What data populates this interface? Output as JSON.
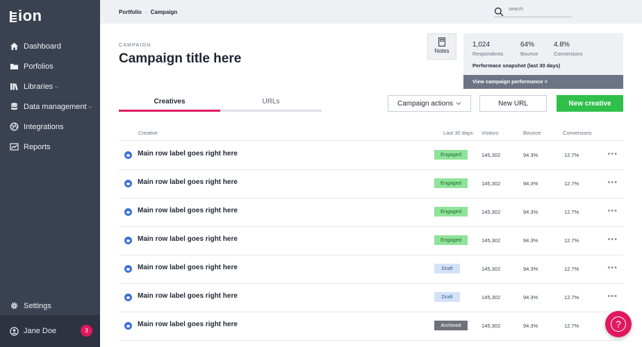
{
  "app": {
    "logo": "ion"
  },
  "sidebar": {
    "items": [
      {
        "label": "Dashboard",
        "icon": "home-icon"
      },
      {
        "label": "Porfolios",
        "icon": "folder-icon"
      },
      {
        "label": "Libraries",
        "icon": "library-icon",
        "chevron": "⌵"
      },
      {
        "label": "Data management",
        "icon": "database-icon",
        "chevron": "⌵"
      },
      {
        "label": "Integrations",
        "icon": "integrations-icon"
      },
      {
        "label": "Reports",
        "icon": "chart-icon"
      }
    ],
    "settings": {
      "label": "Settings",
      "icon": "gear-icon"
    },
    "user": {
      "name": "Jane Doe",
      "badge": "3",
      "icon": "user-icon"
    }
  },
  "header": {
    "breadcrumbs": [
      "Portfolio",
      "Campaign"
    ],
    "search_placeholder": "search"
  },
  "campaign": {
    "kicker": "CAMPAIGN",
    "title": "Campaign title here"
  },
  "notes": {
    "label": "Notes"
  },
  "snapshot": {
    "stats": [
      {
        "value": "1,024",
        "label": "Respondents"
      },
      {
        "value": "64%",
        "label": "Bounce"
      },
      {
        "value": "4.8%",
        "label": "Conversions"
      }
    ],
    "label": "Performace snapshot (last 30 days)",
    "link": "View campaign performance >"
  },
  "tabs": [
    {
      "label": "Creatives",
      "active": true
    },
    {
      "label": "URLs",
      "active": false
    }
  ],
  "actions": {
    "campaign_actions": "Campaign actions",
    "new_url": "New URL",
    "new_creative": "New creative"
  },
  "table": {
    "headers": {
      "creative": "Creative",
      "period": "Last 30 days:",
      "visitors": "Visitors",
      "bounce": "Bounce",
      "conversions": "Conversions"
    },
    "rows": [
      {
        "label": "Main row label goes right here",
        "status": "Engaged",
        "visitors": "145,302",
        "bounce": "94.3%",
        "conversions": "12.7%"
      },
      {
        "label": "Main row label goes right here",
        "status": "Engaged",
        "visitors": "145,302",
        "bounce": "94.3%",
        "conversions": "12.7%"
      },
      {
        "label": "Main row label goes right here",
        "status": "Engaged",
        "visitors": "145,302",
        "bounce": "94.3%",
        "conversions": "12.7%"
      },
      {
        "label": "Main row label goes right here",
        "status": "Engaged",
        "visitors": "145,302",
        "bounce": "94.3%",
        "conversions": "12.7%"
      },
      {
        "label": "Main row label goes right here",
        "status": "Draft",
        "visitors": "145,302",
        "bounce": "94.3%",
        "conversions": "12.7%"
      },
      {
        "label": "Main row label goes right here",
        "status": "Draft",
        "visitors": "145,302",
        "bounce": "94.3%",
        "conversions": "12.7%"
      },
      {
        "label": "Main row label goes right here",
        "status": "Archived",
        "visitors": "145,302",
        "bounce": "94.3%",
        "conversions": "12.7%"
      }
    ],
    "more": "•••"
  },
  "colors": {
    "accent": "#e0195e",
    "primary_button": "#2fbf4a",
    "engaged": "#8fe39a",
    "draft": "#d3e2f7",
    "archived": "#6e7179"
  },
  "help": {
    "icon": "help-icon",
    "glyph": "?"
  }
}
